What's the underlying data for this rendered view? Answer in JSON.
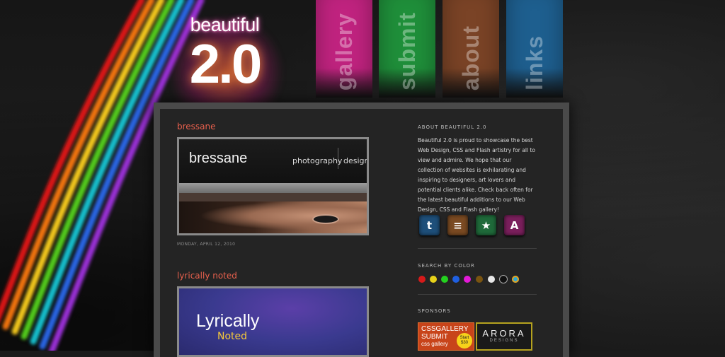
{
  "header": {
    "logo_word": "beautiful",
    "logo_num": "2.0",
    "nav": [
      {
        "label": "gallery",
        "color": "#c0237f"
      },
      {
        "label": "submit",
        "color": "#1f8f3a"
      },
      {
        "label": "about",
        "color": "#7a4326"
      },
      {
        "label": "links",
        "color": "#1e5f8f"
      }
    ]
  },
  "posts": [
    {
      "title": "bressane",
      "thumb": {
        "name": "bressane",
        "tagline_a": "photography",
        "tagline_b": "design"
      },
      "date": "MONDAY, APRIL 12, 2010"
    },
    {
      "title": "lyrically noted",
      "thumb": {
        "name": "Lyrically",
        "sub": "Noted"
      }
    }
  ],
  "sidebar": {
    "about_heading": "ABOUT BEAUTIFUL 2.0",
    "about_text": "Beautiful 2.0 is proud to showcase the best Web Design, CSS and Flash artistry for all to view and admire. We hope that our collection of websites is exhilarating and inspiring to designers, art lovers and potential clients alike. Check back often for the latest beautiful additions to our Web Design, CSS and Flash gallery!",
    "social_icons": [
      {
        "icon": "twitter-icon",
        "glyph": "t",
        "color": "#1e4f7a"
      },
      {
        "icon": "rss-icon",
        "glyph": "≡",
        "color": "#7a4a22"
      },
      {
        "icon": "favorite-icon",
        "glyph": "★",
        "color": "#1f6a3a"
      },
      {
        "icon": "app-icon",
        "glyph": "A",
        "color": "#7a1f5c"
      }
    ],
    "color_heading": "SEARCH BY COLOR",
    "colors": [
      "#d61a1a",
      "#e8d21a",
      "#24d11f",
      "#1f5fe0",
      "#e31ad7",
      "#7a5410",
      "#e8e8e8",
      "#101010",
      "#2aa7d8"
    ],
    "sponsors_heading": "SPONSORS",
    "sponsors": [
      {
        "line1": "CSSGALLERY",
        "line2": "SUBMIT",
        "line3": "css gallery",
        "badge": "Start $30"
      },
      {
        "line1": "ARORA",
        "line2": "DESIGNS"
      }
    ]
  }
}
